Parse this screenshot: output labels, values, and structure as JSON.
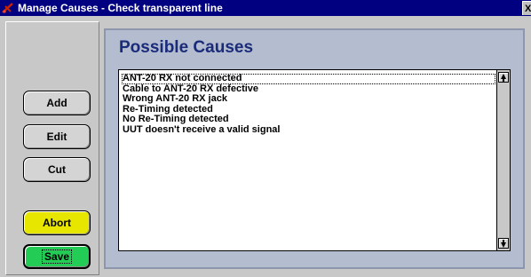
{
  "window": {
    "title": "Manage Causes - Check transparent line",
    "close_label": "X",
    "title_bar_color": "#000080"
  },
  "icons": {
    "app": "manage-causes-app-icon",
    "close": "close-icon",
    "scroll_up": "scroll-up-arrow-icon",
    "scroll_down": "scroll-down-arrow-icon"
  },
  "buttons": {
    "add": "Add",
    "edit": "Edit",
    "cut": "Cut",
    "abort": "Abort",
    "save": "Save"
  },
  "colors": {
    "abort_button": "#e6e600",
    "save_button": "#22cc55",
    "panel_background": "#b4bcd0",
    "panel_title": "#1a2b7a"
  },
  "panel": {
    "title": "Possible Causes"
  },
  "causes": [
    "ANT-20 RX not connected",
    "Cable to ANT-20 RX defective",
    "Wrong ANT-20 RX jack",
    "Re-Timing detected",
    "No Re-Timing detected",
    "UUT doesn't receive a valid signal"
  ]
}
